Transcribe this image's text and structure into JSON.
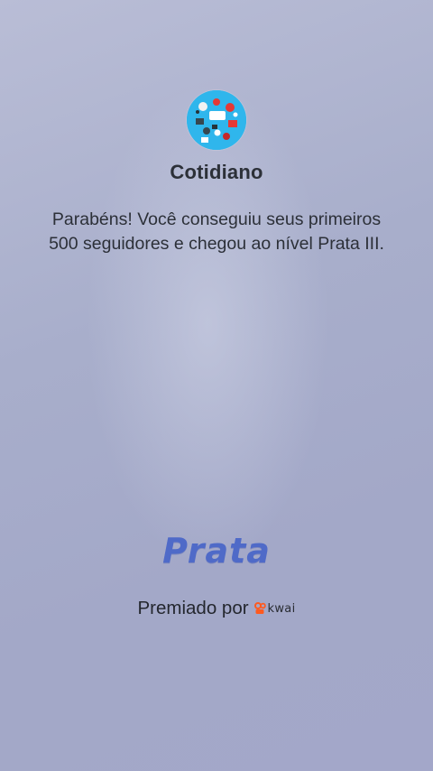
{
  "profile": {
    "avatar_icon": "group-photo-avatar-icon",
    "name": "Cotidiano"
  },
  "congrats": {
    "message": "Parabéns! Você conseguiu seus primeiros 500 seguidores e chegou ao nível Prata III."
  },
  "level": {
    "label": "Prata",
    "color": "#4f6ac8"
  },
  "award": {
    "prefix": "Premiado por",
    "brand_icon": "kwai-logo-icon",
    "brand_name": "kwai",
    "brand_color": "#ff5a1f"
  }
}
